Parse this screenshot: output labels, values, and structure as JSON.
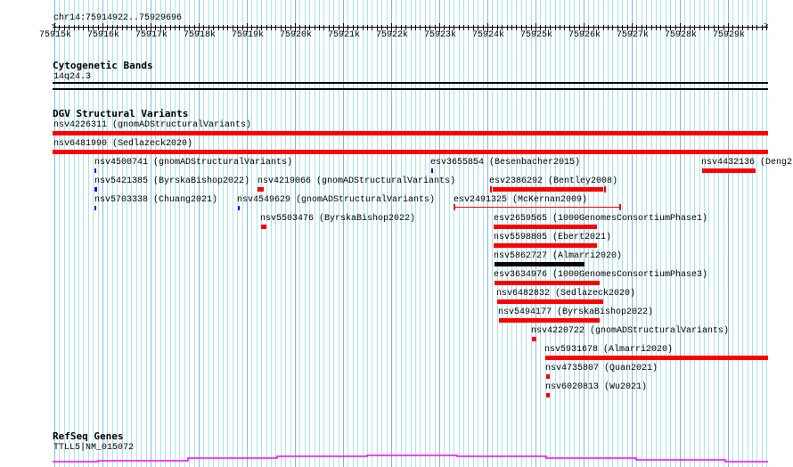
{
  "ruler": {
    "location": "chr14:75914922..75929696",
    "labels": [
      "75915k",
      "75916k",
      "75917k",
      "75918k",
      "75919k",
      "75920k",
      "75921k",
      "75922k",
      "75923k",
      "75924k",
      "75925k",
      "75926k",
      "75927k",
      "75928k",
      "75929k"
    ]
  },
  "cytoband": {
    "title": "Cytogenetic Bands",
    "band": "14q24.3"
  },
  "dgv": {
    "title": "DGV Structural Variants",
    "colors": {
      "gain_loss": "#ff0000",
      "gain": "#0000ff",
      "other": "#000000"
    },
    "features": [
      {
        "label": "nsv4226311 (gnomADStructuralVariants)"
      },
      {
        "label": "nsv6481990 (Sedlazeck2020)"
      },
      {
        "label": "nsv4500741 (gnomADStructuralVariants)"
      },
      {
        "label": "esv3655854 (Besenbacher2015)"
      },
      {
        "label": "nsv4432136 (Deng2"
      },
      {
        "label": "nsv5421385 (ByrskaBishop2022)"
      },
      {
        "label": "nsv4219066 (gnomADStructuralVariants)"
      },
      {
        "label": "esv2386292 (Bentley2008)"
      },
      {
        "label": "nsv5703338 (Chuang2021)"
      },
      {
        "label": "nsv4549629 (gnomADStructuralVariants)"
      },
      {
        "label": "esv2491325 (McKernan2009)"
      },
      {
        "label": "nsv5503476 (ByrskaBishop2022)"
      },
      {
        "label": "esv2659565 (1000GenomesConsortiumPhase1)"
      },
      {
        "label": "nsv5598805 (Ebert2021)"
      },
      {
        "label": "nsv5862727 (Almarri2020)"
      },
      {
        "label": "esv3634976 (1000GenomesConsortiumPhase3)"
      },
      {
        "label": "nsv6482832 (Sedlazeck2020)"
      },
      {
        "label": "nsv5494177 (ByrskaBishop2022)"
      },
      {
        "label": "nsv4220722 (gnomADStructuralVariants)"
      },
      {
        "label": "nsv5931678 (Almarri2020)"
      },
      {
        "label": "nsv4735807 (Quan2021)"
      },
      {
        "label": "nsv6020813 (Wu2021)"
      }
    ]
  },
  "refseq": {
    "title": "RefSeq Genes",
    "gene": "TTLL5|NM_015072",
    "color": "#ff00ff"
  }
}
